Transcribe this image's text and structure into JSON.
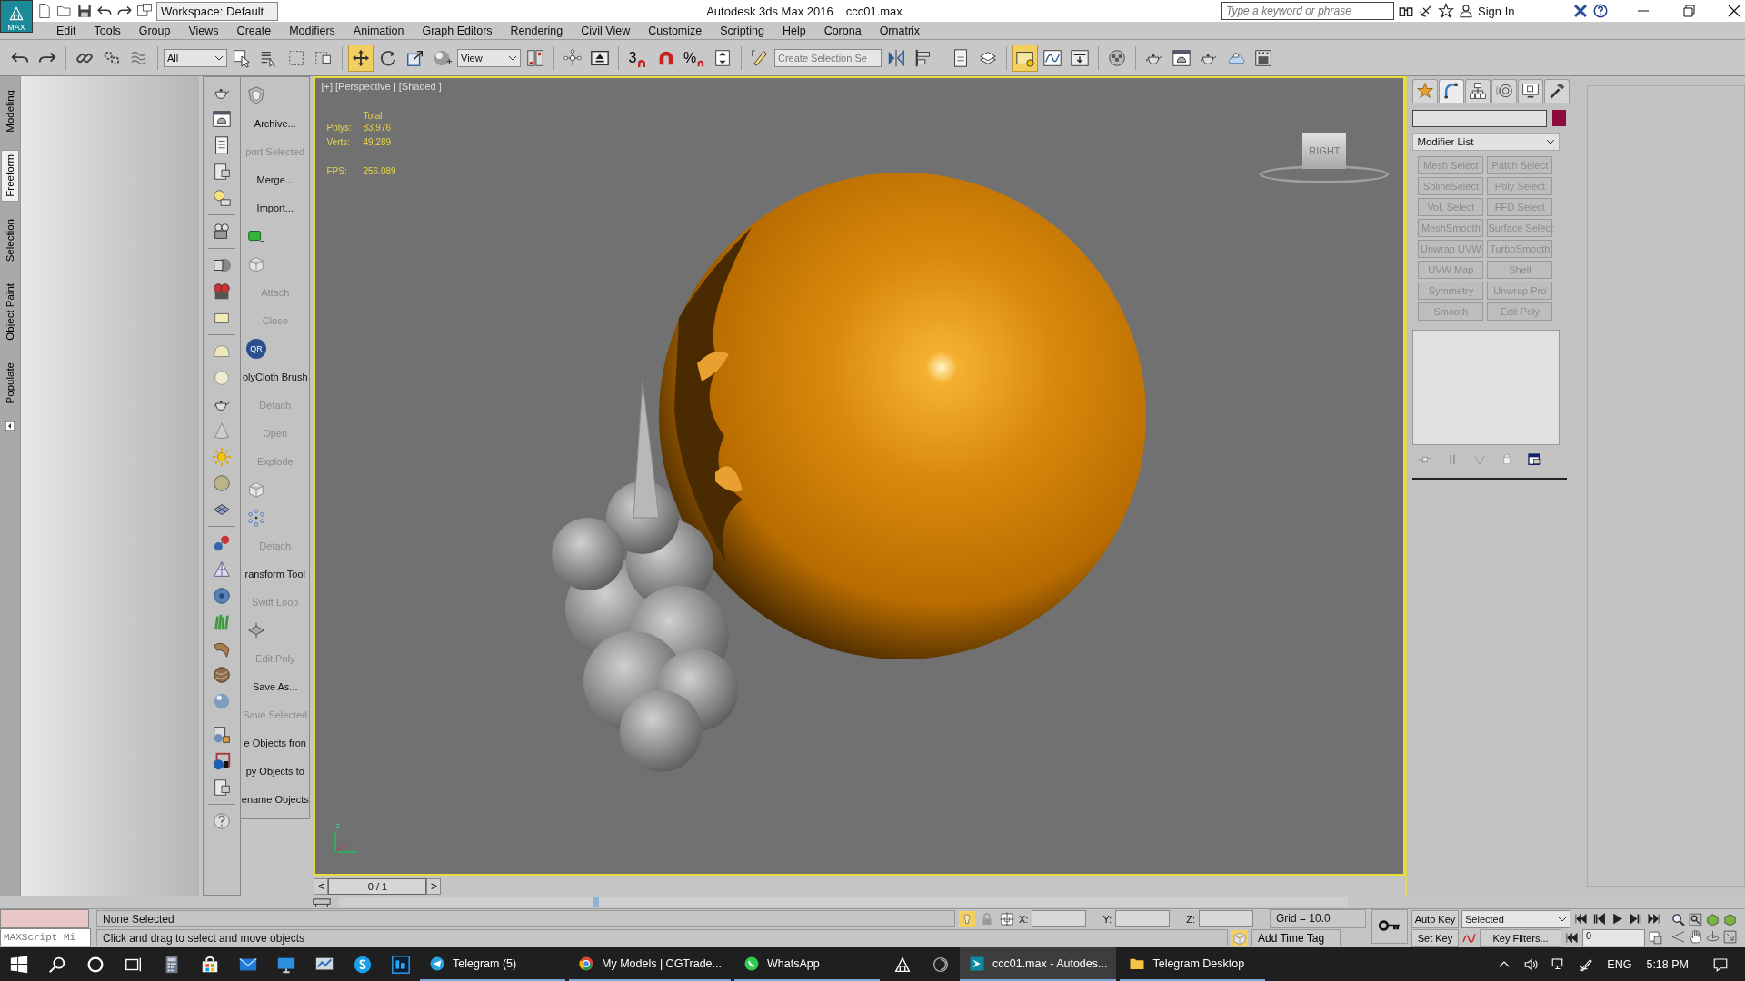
{
  "title_bar": {
    "app_button": "MAX",
    "workspace": "Workspace: Default",
    "title": "Autodesk 3ds Max 2016",
    "file": "ccc01.max",
    "search_placeholder": "Type a keyword or phrase",
    "sign_in": "Sign In"
  },
  "menu": [
    "Edit",
    "Tools",
    "Group",
    "Views",
    "Create",
    "Modifiers",
    "Animation",
    "Graph Editors",
    "Rendering",
    "Civil View",
    "Customize",
    "Scripting",
    "Help",
    "Corona",
    "Ornatrix"
  ],
  "toolbar": [
    {
      "kind": "button",
      "selected": false
    },
    {
      "kind": "button",
      "selected": false
    },
    {
      "kind": "sep"
    },
    {
      "kind": "button",
      "selected": false
    },
    {
      "kind": "button",
      "selected": false
    },
    {
      "kind": "button",
      "selected": false
    },
    {
      "kind": "sep"
    },
    {
      "kind": "dropdown",
      "value": "All"
    },
    {
      "kind": "button",
      "selected": false
    },
    {
      "kind": "button",
      "selected": false
    },
    {
      "kind": "button",
      "selected": false
    },
    {
      "kind": "button",
      "selected": false
    },
    {
      "kind": "sep"
    },
    {
      "kind": "button",
      "selected": true
    },
    {
      "kind": "button",
      "selected": false
    },
    {
      "kind": "button",
      "selected": false
    },
    {
      "kind": "button",
      "selected": false
    },
    {
      "kind": "dropdown",
      "value": "View"
    },
    {
      "kind": "button",
      "selected": false
    },
    {
      "kind": "sep"
    },
    {
      "kind": "button",
      "selected": false
    },
    {
      "kind": "button",
      "selected": false
    },
    {
      "kind": "sep"
    },
    {
      "kind": "snap",
      "label": "3"
    },
    {
      "kind": "button",
      "selected": false
    },
    {
      "kind": "snap",
      "label": "%"
    },
    {
      "kind": "button",
      "selected": false
    },
    {
      "kind": "sep"
    },
    {
      "kind": "button",
      "selected": false
    },
    {
      "kind": "field",
      "placeholder": "Create Selection Se"
    },
    {
      "kind": "button",
      "selected": false
    },
    {
      "kind": "button",
      "selected": false
    },
    {
      "kind": "sep"
    },
    {
      "kind": "button",
      "selected": false
    },
    {
      "kind": "button",
      "selected": false
    },
    {
      "kind": "sep"
    },
    {
      "kind": "button",
      "selected": true
    },
    {
      "kind": "button",
      "selected": false
    },
    {
      "kind": "button",
      "selected": false
    },
    {
      "kind": "sep"
    },
    {
      "kind": "button",
      "selected": false
    },
    {
      "kind": "sep"
    },
    {
      "kind": "button",
      "selected": false
    },
    {
      "kind": "button",
      "selected": false
    },
    {
      "kind": "button",
      "selected": false
    },
    {
      "kind": "button",
      "selected": false
    },
    {
      "kind": "button",
      "selected": false
    }
  ],
  "side_tabs": [
    {
      "label": "Modeling",
      "selected": false
    },
    {
      "label": "Freeform",
      "selected": true
    },
    {
      "label": "Selection",
      "selected": false
    },
    {
      "label": "Object Paint",
      "selected": false
    },
    {
      "label": "Populate",
      "selected": false
    }
  ],
  "tools_panel": [
    {
      "kind": "icon"
    },
    {
      "kind": "text",
      "label": "Archive...",
      "disabled": false
    },
    {
      "kind": "text",
      "label": "port Selected",
      "disabled": true
    },
    {
      "kind": "text",
      "label": "Merge...",
      "disabled": false
    },
    {
      "kind": "text",
      "label": "Import...",
      "disabled": false
    },
    {
      "kind": "icon"
    },
    {
      "kind": "icon"
    },
    {
      "kind": "text",
      "label": "Attach",
      "disabled": true
    },
    {
      "kind": "text",
      "label": "Close",
      "disabled": true
    },
    {
      "kind": "badge",
      "label": "QR"
    },
    {
      "kind": "text",
      "label": "olyCloth Brush",
      "disabled": false
    },
    {
      "kind": "text",
      "label": "Detach",
      "disabled": true
    },
    {
      "kind": "text",
      "label": "Open",
      "disabled": true
    },
    {
      "kind": "text",
      "label": "Explode",
      "disabled": true
    },
    {
      "kind": "icon"
    },
    {
      "kind": "icon"
    },
    {
      "kind": "text",
      "label": "Detach",
      "disabled": true
    },
    {
      "kind": "text",
      "label": "ransform Tool",
      "disabled": false
    },
    {
      "kind": "text",
      "label": "Swift Loop",
      "disabled": true
    },
    {
      "kind": "icon"
    },
    {
      "kind": "text",
      "label": "Edit Poly",
      "disabled": true
    },
    {
      "kind": "text",
      "label": "Save As...",
      "disabled": false
    },
    {
      "kind": "text",
      "label": "Save Selected",
      "disabled": true
    },
    {
      "kind": "text",
      "label": "e Objects fron",
      "disabled": false
    },
    {
      "kind": "text",
      "label": "py Objects to",
      "disabled": false
    },
    {
      "kind": "text",
      "label": "ename Objects",
      "disabled": false
    }
  ],
  "viewport": {
    "label": "[+] [Perspective ] [Shaded ]",
    "active": true,
    "stats_header": "Total",
    "stats": [
      {
        "label": "Polys:",
        "value": "83,976"
      },
      {
        "label": "Verts:",
        "value": "49,289"
      }
    ],
    "fps": {
      "label": "FPS:",
      "value": "256.089"
    },
    "viewcube": "RIGHT",
    "axis": "z"
  },
  "timeline": {
    "prev": "<",
    "frame": "0 / 1",
    "next": ">"
  },
  "command_panel": {
    "tabs": [
      {
        "selected": false
      },
      {
        "selected": true
      },
      {
        "selected": false
      },
      {
        "selected": false
      },
      {
        "selected": false
      },
      {
        "selected": false
      }
    ],
    "modifier_list": "Modifier List",
    "modifiers": [
      {
        "label": "Mesh Select",
        "disabled": true
      },
      {
        "label": "Patch Select",
        "disabled": true
      },
      {
        "label": "SplineSelect",
        "disabled": true
      },
      {
        "label": "Poly Select",
        "disabled": true
      },
      {
        "label": "Vol. Select",
        "disabled": true
      },
      {
        "label": "FFD Select",
        "disabled": true
      },
      {
        "label": "MeshSmooth",
        "disabled": true
      },
      {
        "label": "Surface Select",
        "disabled": true
      },
      {
        "label": "Unwrap UVW",
        "disabled": true
      },
      {
        "label": "TurboSmooth",
        "disabled": true
      },
      {
        "label": "UVW Map",
        "disabled": true
      },
      {
        "label": "Shell",
        "disabled": true
      },
      {
        "label": "Symmetry",
        "disabled": true
      },
      {
        "label": "Unwrap Pro",
        "disabled": true
      },
      {
        "label": "Smooth",
        "disabled": true
      },
      {
        "label": "Edit Poly",
        "disabled": true
      }
    ]
  },
  "status": {
    "listener_placeholder": "MAXScript Mi",
    "selection": "None Selected",
    "prompt": "Click and drag to select and move objects",
    "x_label": "X:",
    "y_label": "Y:",
    "z_label": "Z:",
    "grid": "Grid = 10.0",
    "time_tag": "Add Time Tag",
    "auto_key": "Auto Key",
    "key_mode": "Selected",
    "set_key": "Set Key",
    "key_filters": "Key Filters...",
    "frame": "0"
  },
  "taskbar": {
    "items": [
      {
        "label": "Telegram (5)",
        "selected": false
      },
      {
        "label": "My Models | CGTrade...",
        "selected": false
      },
      {
        "label": "WhatsApp",
        "selected": false
      },
      {
        "label": "ccc01.max - Autodes...",
        "selected": true
      },
      {
        "label": "Telegram Desktop",
        "selected": false
      }
    ],
    "language": "ENG",
    "time": "5:18 PM"
  }
}
